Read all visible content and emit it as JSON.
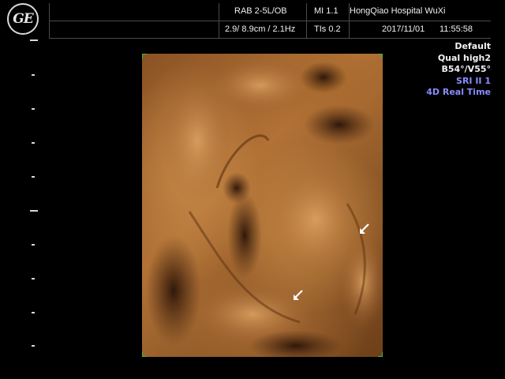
{
  "header": {
    "logo_text": "GE",
    "probe": "RAB 2-5L/OB",
    "mi": "MI 1.1",
    "hospital": "HongQiao Hospital WuXi",
    "depth_freq": "2.9/ 8.9cm / 2.1Hz",
    "tis": "TIs 0.2",
    "date": "2017/11/01",
    "time": "11:55:58"
  },
  "info_panel": {
    "preset": "Default",
    "quality": "Qual high2",
    "angles": "B54°/V55°",
    "sri": "SRI II 1",
    "mode": "4D Real Time"
  },
  "colors": {
    "background": "#000000",
    "render_tone": "#b27236",
    "info_blue": "#8a8cff",
    "roi_corner": "#3fb83f"
  },
  "icons": [
    "ge-logo-icon",
    "arrow-marker-icon"
  ]
}
